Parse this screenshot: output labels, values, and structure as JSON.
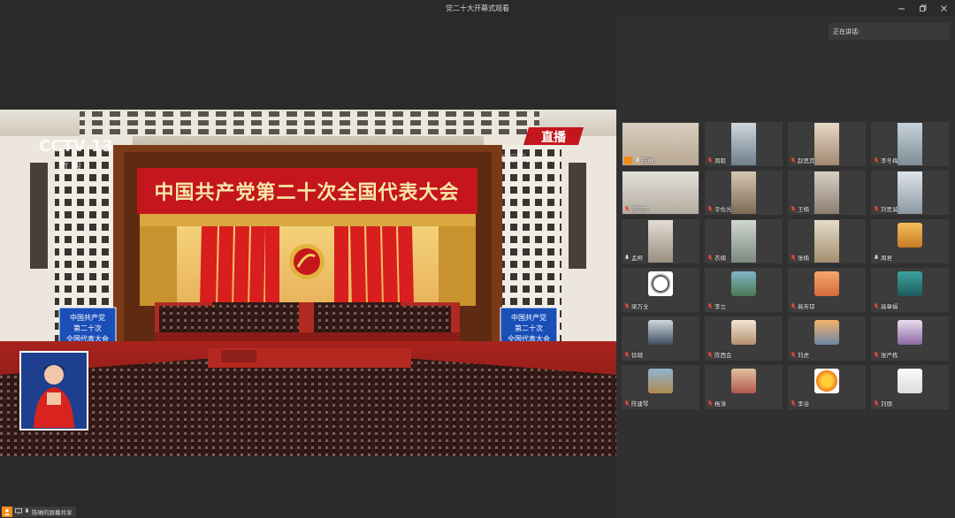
{
  "window": {
    "title": "党二十大开幕式观看",
    "controls": [
      "minimize-icon",
      "restore-icon",
      "close-icon"
    ]
  },
  "video": {
    "channel_logo": "CCTV 13",
    "channel_sub": "新 闻",
    "live_badge": "直播",
    "watermark": "CCTV.com",
    "banner": "中国共产党第二十次全国代表大会",
    "left_sign": [
      "中国共产党",
      "第二十次",
      "全国代表大会"
    ],
    "right_sign": [
      "中国共产党",
      "第二十次",
      "全国代表大会"
    ]
  },
  "panel": {
    "speaking_label": "正在讲话:"
  },
  "participants": [
    {
      "name": "陈琳",
      "host": true,
      "muted": false
    },
    {
      "name": "周毅",
      "muted": true
    },
    {
      "name": "赵思宾",
      "muted": true
    },
    {
      "name": "李冬梅",
      "muted": true
    },
    {
      "name": "陈正杰",
      "muted": true
    },
    {
      "name": "辛佐光",
      "muted": true
    },
    {
      "name": "王楠",
      "muted": true
    },
    {
      "name": "刘思诚",
      "muted": true
    },
    {
      "name": "孟柯",
      "muted": false
    },
    {
      "name": "衣楠",
      "muted": true
    },
    {
      "name": "张楠",
      "muted": true
    },
    {
      "name": "周君",
      "muted": false
    },
    {
      "name": "梁万全",
      "muted": true
    },
    {
      "name": "李立",
      "muted": true
    },
    {
      "name": "裴芳琼",
      "muted": true
    },
    {
      "name": "高章娟",
      "muted": true
    },
    {
      "name": "徐璐",
      "muted": true
    },
    {
      "name": "陈西会",
      "muted": true
    },
    {
      "name": "刘虎",
      "muted": true
    },
    {
      "name": "张严栋",
      "muted": true
    },
    {
      "name": "陈建琴",
      "muted": true
    },
    {
      "name": "杨涛",
      "muted": true
    },
    {
      "name": "李治",
      "muted": true
    },
    {
      "name": "刘朋",
      "muted": true
    }
  ],
  "bottom": {
    "share_label": "陈琳的屏幕共享"
  },
  "colors": {
    "accent": "#f08c1a",
    "mute_red": "#e24b3b",
    "banner_red": "#c4161c"
  }
}
